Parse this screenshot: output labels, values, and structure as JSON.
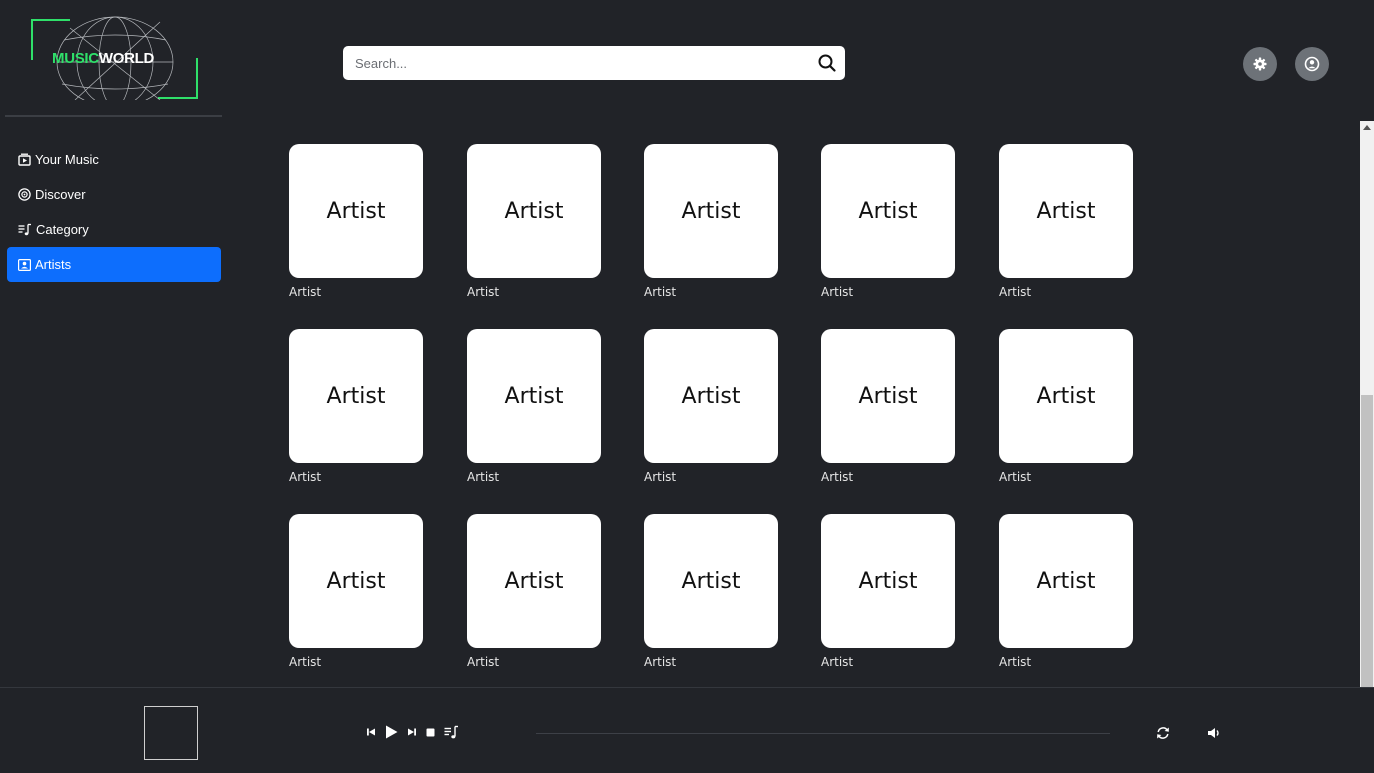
{
  "logo": {
    "text_green": "MUSIC",
    "text_white": "WORLD",
    "accent": "#2fe06a"
  },
  "search": {
    "placeholder": "Search...",
    "value": ""
  },
  "header": {
    "settings_icon": "gear-icon",
    "profile_icon": "user-circle-icon"
  },
  "sidebar": {
    "items": [
      {
        "label": "Your Music",
        "icon": "music-library-icon",
        "active": false
      },
      {
        "label": "Discover",
        "icon": "disc-icon",
        "active": false
      },
      {
        "label": "Category",
        "icon": "playlist-icon",
        "active": false
      },
      {
        "label": "Artists",
        "icon": "person-card-icon",
        "active": true
      }
    ]
  },
  "artists": {
    "rows": [
      [
        {
          "image_text": "Artist",
          "label": "Artist"
        },
        {
          "image_text": "Artist",
          "label": "Artist"
        },
        {
          "image_text": "Artist",
          "label": "Artist"
        },
        {
          "image_text": "Artist",
          "label": "Artist"
        },
        {
          "image_text": "Artist",
          "label": "Artist"
        }
      ],
      [
        {
          "image_text": "Artist",
          "label": "Artist"
        },
        {
          "image_text": "Artist",
          "label": "Artist"
        },
        {
          "image_text": "Artist",
          "label": "Artist"
        },
        {
          "image_text": "Artist",
          "label": "Artist"
        },
        {
          "image_text": "Artist",
          "label": "Artist"
        }
      ],
      [
        {
          "image_text": "Artist",
          "label": "Artist"
        },
        {
          "image_text": "Artist",
          "label": "Artist"
        },
        {
          "image_text": "Artist",
          "label": "Artist"
        },
        {
          "image_text": "Artist",
          "label": "Artist"
        },
        {
          "image_text": "Artist",
          "label": "Artist"
        }
      ]
    ]
  },
  "player": {
    "controls": [
      "previous-icon",
      "play-icon",
      "next-icon",
      "stop-icon",
      "queue-icon"
    ],
    "right_controls": [
      "repeat-icon",
      "volume-icon"
    ],
    "progress": 0
  },
  "colors": {
    "background": "#212328",
    "active": "#0d6efd",
    "card": "#ffffff"
  }
}
